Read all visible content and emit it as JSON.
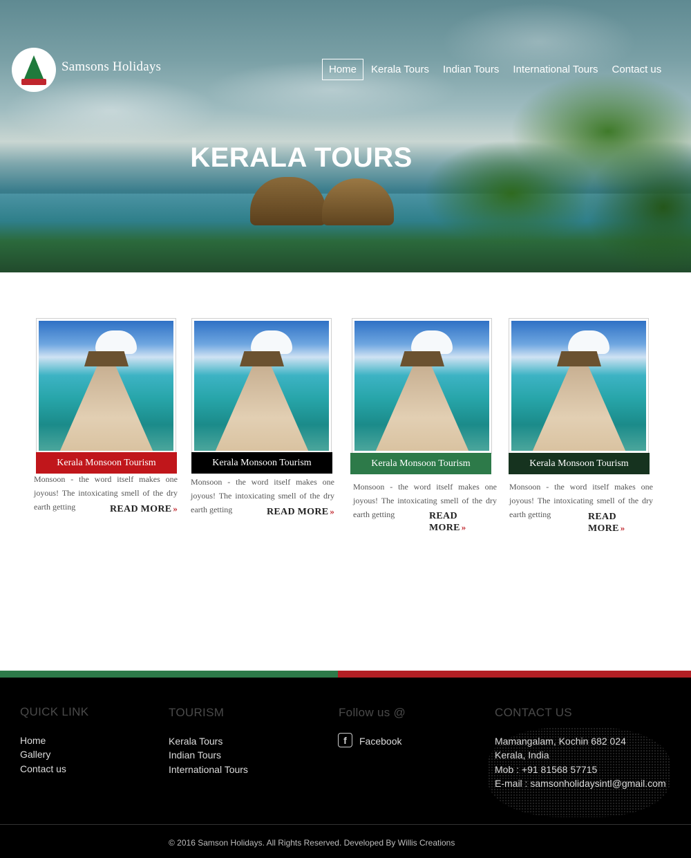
{
  "brand": {
    "name": "Samsons Holidays"
  },
  "nav": {
    "items": [
      {
        "label": "Home",
        "active": true
      },
      {
        "label": "Kerala Tours",
        "active": false
      },
      {
        "label": "Indian Tours",
        "active": false
      },
      {
        "label": "International Tours",
        "active": false
      },
      {
        "label": "Contact us",
        "active": false
      }
    ]
  },
  "hero": {
    "title": "KERALA TOURS"
  },
  "cards": [
    {
      "title": "Kerala Monsoon Tourism",
      "color": "#c0161b",
      "desc": "Monsoon - the word itself makes one joyous! The intoxicating smell of the dry earth getting",
      "more": "READ MORE"
    },
    {
      "title": "Kerala Monsoon Tourism",
      "color": "#000000",
      "desc": "Monsoon - the word itself makes one joyous! The intoxicating smell of the dry earth getting",
      "more": "READ MORE"
    },
    {
      "title": "Kerala Monsoon Tourism",
      "color": "#2d7a49",
      "desc": "Monsoon - the word itself makes one joyous! The intoxicating smell of the dry earth getting",
      "more": "READ MORE"
    },
    {
      "title": "Kerala Monsoon Tourism",
      "color": "#16331f",
      "desc": "Monsoon - the word itself makes one joyous! The intoxicating smell of the dry earth getting",
      "more": "READ MORE"
    }
  ],
  "footer": {
    "quick_link": {
      "heading": "QUICK LINK",
      "items": [
        "Home",
        "Gallery",
        "Contact us"
      ]
    },
    "tourism": {
      "heading": "TOURISM",
      "items": [
        "Kerala Tours",
        "Indian Tours",
        "International Tours"
      ]
    },
    "follow": {
      "heading": "Follow us @",
      "facebook": "Facebook"
    },
    "contact": {
      "heading": "CONTACT US",
      "address1": "Mamangalam, Kochin 682 024",
      "address2": "Kerala, India",
      "mob": "Mob : +91 81568 57715",
      "email": "E-mail : samsonholidaysintl@gmail.com"
    },
    "copyright": "© 2016 Samson Holidays. All Rights Reserved. Developed By Willis Creations"
  },
  "colors": {
    "green": "#2d7a49",
    "red": "#b21f24",
    "chevron": "#c0262d"
  }
}
